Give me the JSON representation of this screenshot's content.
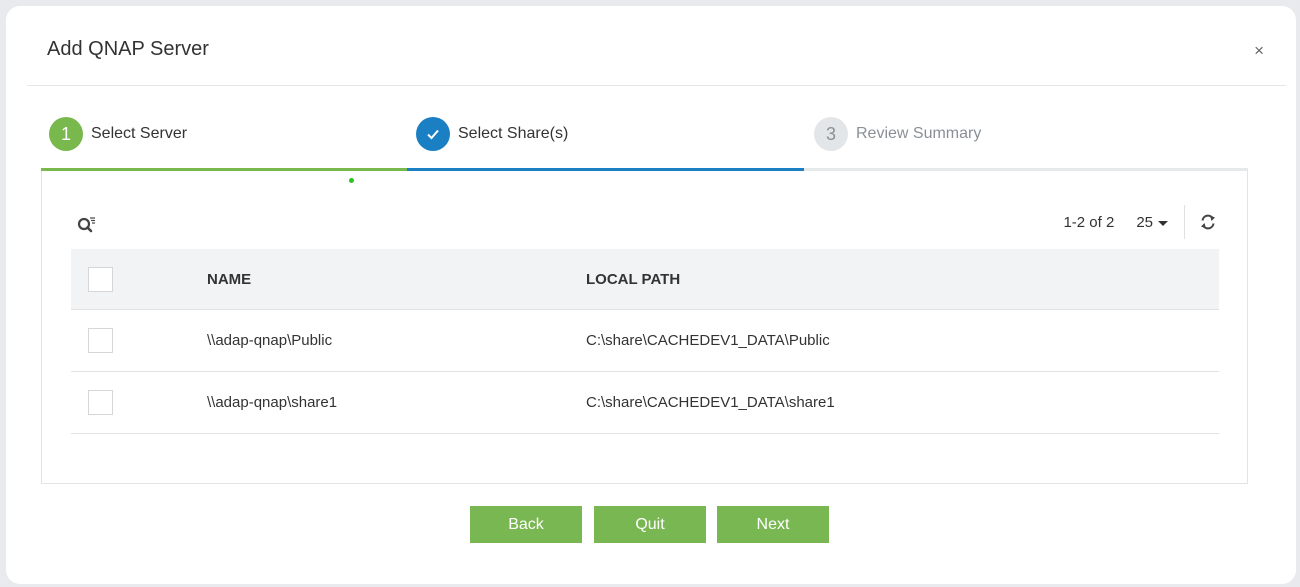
{
  "dialog": {
    "title": "Add QNAP Server",
    "close_label": "×"
  },
  "steps": [
    {
      "number": "1",
      "label": "Select Server",
      "state": "completed"
    },
    {
      "number": "✓",
      "label": "Select Share(s)",
      "state": "active"
    },
    {
      "number": "3",
      "label": "Review Summary",
      "state": "pending"
    }
  ],
  "toolbar": {
    "search_icon": "search-filter-icon",
    "pager_range": "1-2 of 2",
    "page_size": "25",
    "refresh_icon": "refresh-icon"
  },
  "table": {
    "columns": [
      "NAME",
      "LOCAL PATH"
    ],
    "rows": [
      {
        "name": "\\\\adap-qnap\\Public",
        "local_path": "C:\\share\\CACHEDEV1_DATA\\Public",
        "checked": false
      },
      {
        "name": "\\\\adap-qnap\\share1",
        "local_path": "C:\\share\\CACHEDEV1_DATA\\share1",
        "checked": false
      }
    ]
  },
  "buttons": {
    "back": "Back",
    "quit": "Quit",
    "next": "Next"
  },
  "colors": {
    "completed": "#78b84c",
    "active": "#1a7fc3",
    "pending": "#e3e6e8",
    "button": "#79b752"
  }
}
